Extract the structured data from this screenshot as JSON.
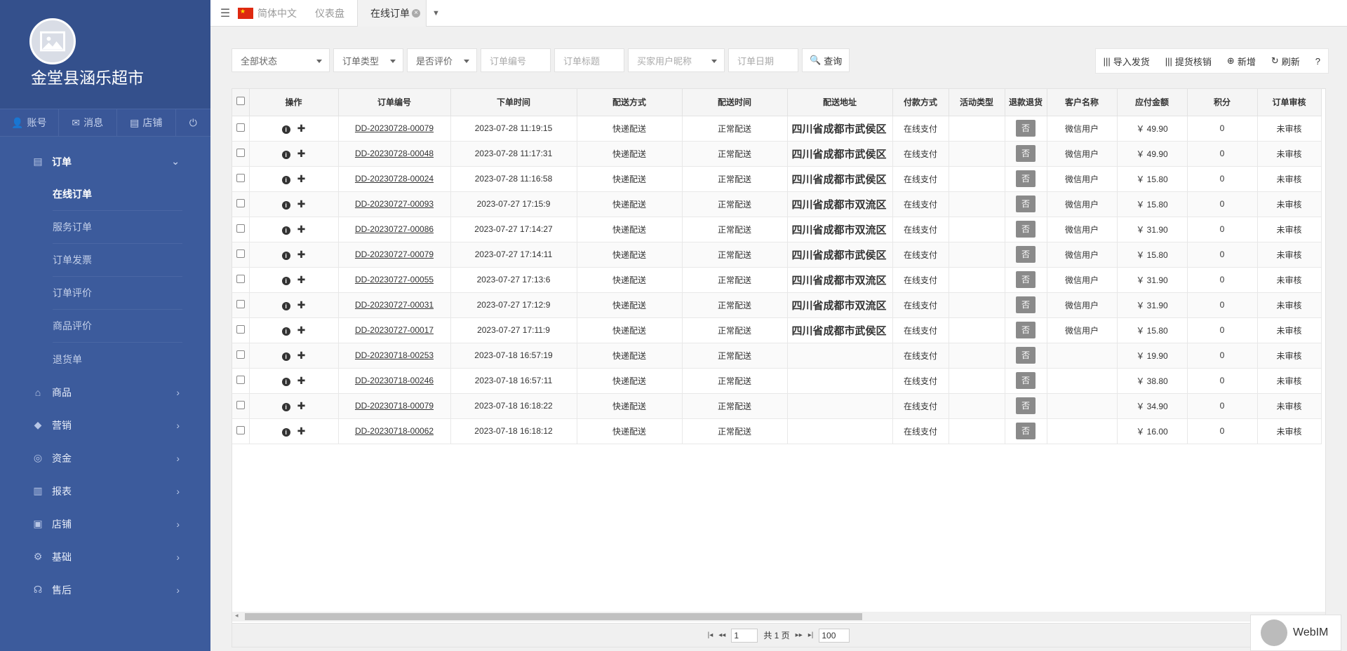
{
  "brand": {
    "name": "金堂县涵乐超市"
  },
  "quick": [
    {
      "icon": "user-icon",
      "label": "账号"
    },
    {
      "icon": "mail-icon",
      "label": "消息"
    },
    {
      "icon": "store-icon",
      "label": "店铺"
    }
  ],
  "menu": {
    "order": "订单",
    "subs": [
      "在线订单",
      "服务订单",
      "订单发票",
      "订单评价",
      "商品评价",
      "退货单"
    ],
    "groups": [
      "商品",
      "营销",
      "资金",
      "报表",
      "店铺",
      "基础",
      "售后"
    ]
  },
  "topbar": {
    "lang": "简体中文",
    "tabs": [
      "仪表盘",
      "在线订单"
    ]
  },
  "filters": {
    "status": "全部状态",
    "type": "订单类型",
    "review": "是否评价",
    "order_no": "订单编号",
    "order_title": "订单标题",
    "buyer": "买家用户昵称",
    "date": "订单日期",
    "query": "查询"
  },
  "actions": {
    "import": "导入发货",
    "verify": "提货核销",
    "add": "新增",
    "refresh": "刷新",
    "help": "?"
  },
  "table": {
    "headers": [
      "操作",
      "订单编号",
      "下单时间",
      "配送方式",
      "配送时间",
      "配送地址",
      "付款方式",
      "活动类型",
      "退款退货",
      "客户名称",
      "应付金额",
      "积分",
      "订单审核"
    ],
    "rows": [
      [
        "DD-20230728-00079",
        "2023-07-28 11:19:15",
        "快递配送",
        "正常配送",
        "四川省成都市武侯区",
        "在线支付",
        "",
        "否",
        "微信用户",
        "￥ 49.90",
        "0",
        "未审核"
      ],
      [
        "DD-20230728-00048",
        "2023-07-28 11:17:31",
        "快递配送",
        "正常配送",
        "四川省成都市武侯区",
        "在线支付",
        "",
        "否",
        "微信用户",
        "￥ 49.90",
        "0",
        "未审核"
      ],
      [
        "DD-20230728-00024",
        "2023-07-28 11:16:58",
        "快递配送",
        "正常配送",
        "四川省成都市武侯区",
        "在线支付",
        "",
        "否",
        "微信用户",
        "￥ 15.80",
        "0",
        "未审核"
      ],
      [
        "DD-20230727-00093",
        "2023-07-27 17:15:9",
        "快递配送",
        "正常配送",
        "四川省成都市双流区",
        "在线支付",
        "",
        "否",
        "微信用户",
        "￥ 15.80",
        "0",
        "未审核"
      ],
      [
        "DD-20230727-00086",
        "2023-07-27 17:14:27",
        "快递配送",
        "正常配送",
        "四川省成都市双流区",
        "在线支付",
        "",
        "否",
        "微信用户",
        "￥ 31.90",
        "0",
        "未审核"
      ],
      [
        "DD-20230727-00079",
        "2023-07-27 17:14:11",
        "快递配送",
        "正常配送",
        "四川省成都市武侯区",
        "在线支付",
        "",
        "否",
        "微信用户",
        "￥ 15.80",
        "0",
        "未审核"
      ],
      [
        "DD-20230727-00055",
        "2023-07-27 17:13:6",
        "快递配送",
        "正常配送",
        "四川省成都市双流区",
        "在线支付",
        "",
        "否",
        "微信用户",
        "￥ 31.90",
        "0",
        "未审核"
      ],
      [
        "DD-20230727-00031",
        "2023-07-27 17:12:9",
        "快递配送",
        "正常配送",
        "四川省成都市双流区",
        "在线支付",
        "",
        "否",
        "微信用户",
        "￥ 31.90",
        "0",
        "未审核"
      ],
      [
        "DD-20230727-00017",
        "2023-07-27 17:11:9",
        "快递配送",
        "正常配送",
        "四川省成都市武侯区",
        "在线支付",
        "",
        "否",
        "微信用户",
        "￥ 15.80",
        "0",
        "未审核"
      ],
      [
        "DD-20230718-00253",
        "2023-07-18 16:57:19",
        "快递配送",
        "正常配送",
        "",
        "在线支付",
        "",
        "否",
        "",
        "￥ 19.90",
        "0",
        "未审核"
      ],
      [
        "DD-20230718-00246",
        "2023-07-18 16:57:11",
        "快递配送",
        "正常配送",
        "",
        "在线支付",
        "",
        "否",
        "",
        "￥ 38.80",
        "0",
        "未审核"
      ],
      [
        "DD-20230718-00079",
        "2023-07-18 16:18:22",
        "快递配送",
        "正常配送",
        "",
        "在线支付",
        "",
        "否",
        "",
        "￥ 34.90",
        "0",
        "未审核"
      ],
      [
        "DD-20230718-00062",
        "2023-07-18 16:18:12",
        "快递配送",
        "正常配送",
        "",
        "在线支付",
        "",
        "否",
        "",
        "￥ 16.00",
        "0",
        "未审核"
      ]
    ]
  },
  "pager": {
    "page": "1",
    "total": "共 1 页",
    "size": "100"
  },
  "webim": {
    "label": "WebIM"
  }
}
